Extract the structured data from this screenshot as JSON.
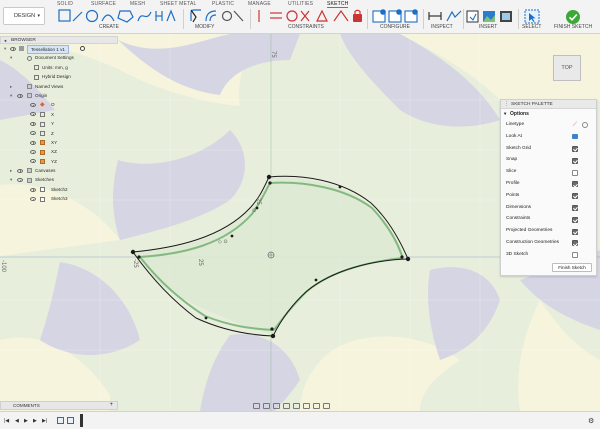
{
  "toolbar": {
    "workspace": "DESIGN",
    "tabs": [
      "SOLID",
      "SURFACE",
      "MESH",
      "SHEET METAL",
      "PLASTIC",
      "MANAGE",
      "UTILITIES",
      "SKETCH"
    ],
    "active_tab": "SKETCH",
    "groups": [
      "CREATE",
      "MODIFY",
      "CONSTRAINTS",
      "CONFIGURE",
      "INSPECT",
      "INSERT",
      "SELECT",
      "FINISH SKETCH"
    ]
  },
  "browser": {
    "title": "BROWSER",
    "items": [
      {
        "label": "Tessellation 1 v1"
      },
      {
        "label": "Document Settings"
      },
      {
        "label": "Units: mm, g"
      },
      {
        "label": "Hybrid Design"
      },
      {
        "label": "Named Views"
      },
      {
        "label": "Origin"
      },
      {
        "label": "O"
      },
      {
        "label": "X"
      },
      {
        "label": "Y"
      },
      {
        "label": "Z"
      },
      {
        "label": "XY"
      },
      {
        "label": "XZ"
      },
      {
        "label": "YZ"
      },
      {
        "label": "Canvases"
      },
      {
        "label": "Sketches"
      },
      {
        "label": "Sketch2"
      },
      {
        "label": "Sketch3"
      }
    ]
  },
  "palette": {
    "title": "SKETCH PALETTE",
    "section": "Options",
    "rows": [
      {
        "label": "Linetype",
        "checked": null
      },
      {
        "label": "Look At",
        "checked": null
      },
      {
        "label": "Sketch Grid",
        "checked": true
      },
      {
        "label": "Snap",
        "checked": true
      },
      {
        "label": "Slice",
        "checked": false
      },
      {
        "label": "Profile",
        "checked": true
      },
      {
        "label": "Points",
        "checked": true
      },
      {
        "label": "Dimensions",
        "checked": true
      },
      {
        "label": "Constraints",
        "checked": true
      },
      {
        "label": "Projected Geometries",
        "checked": true
      },
      {
        "label": "Construction Geometries",
        "checked": true
      },
      {
        "label": "3D Sketch",
        "checked": false
      }
    ],
    "finish_button": "Finish Sketch"
  },
  "viewcube": {
    "label": "TOP"
  },
  "comments": {
    "label": "COMMENTS"
  },
  "canvas": {
    "axis_labels": [
      "-100",
      "-25",
      "25",
      "-25",
      "75"
    ]
  },
  "colors": {
    "bg_yellow": "#f6f4dd",
    "bg_purple": "#d6d5e4",
    "bg_green": "#e8eedc",
    "profile_fill": "#dde9d3",
    "construction": "#73b173",
    "accent_blue": "#1e88e5"
  }
}
